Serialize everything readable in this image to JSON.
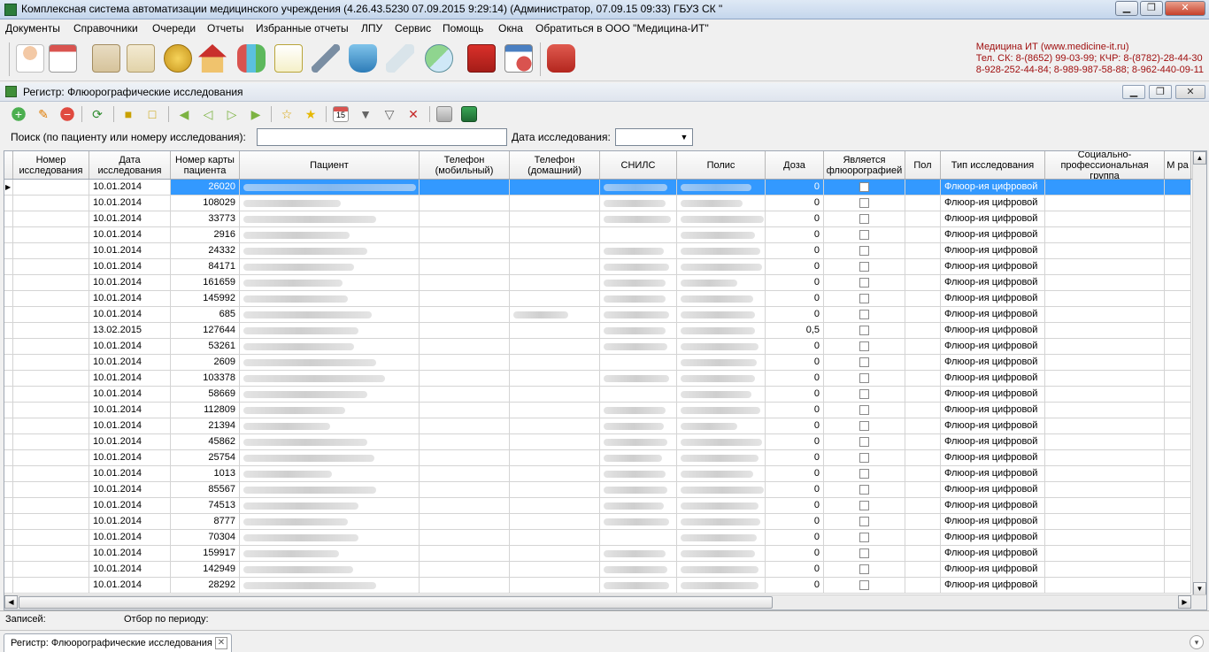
{
  "window": {
    "title": "Комплексная система автоматизации медицинского учреждения (4.26.43.5230 07.09.2015 9:29:14) (Администратор, 07.09.15 09:33) ГБУЗ СК \"",
    "min_label": "▁",
    "max_label": "❐",
    "close_label": "✕"
  },
  "menu": [
    "Документы",
    "Справочники",
    "Очереди",
    "Отчеты",
    "Избранные отчеты",
    "ЛПУ",
    "Сервис",
    "Помощь",
    "Окна",
    "Обратиться в ООО \"Медицина-ИТ\""
  ],
  "contact": {
    "line1": "Медицина ИТ (www.medicine-it.ru)",
    "line2": "Тел. СК: 8-(8652) 99-03-99; КЧР: 8-(8782)-28-44-30",
    "line3": "8-928-252-44-84; 8-989-987-58-88; 8-962-440-09-11"
  },
  "colors": {
    "accent": "#3399ff",
    "contact": "#a01010"
  },
  "child": {
    "title": "Регистр: Флюорографические исследования",
    "min_label": "▁",
    "max_label": "❐",
    "close_label": "✕"
  },
  "search": {
    "label": "Поиск (по пациенту или номеру исследования):",
    "value": "",
    "date_label": "Дата исследования:",
    "date_value": ""
  },
  "columns": [
    "Номер исследования",
    "Дата исследования",
    "Номер карты пациента",
    "Пациент",
    "Телефон (мобильный)",
    "Телефон (домашний)",
    "СНИЛС",
    "Полис",
    "Доза",
    "Является флюорографией",
    "Пол",
    "Тип исследования",
    "Социально-профессиональная группа",
    "М ра"
  ],
  "rows": [
    {
      "date": "10.01.2014",
      "card": "26020",
      "dose": "0",
      "type": "Флюор-ия цифровой"
    },
    {
      "date": "10.01.2014",
      "card": "108029",
      "dose": "0",
      "type": "Флюор-ия цифровой"
    },
    {
      "date": "10.01.2014",
      "card": "33773",
      "dose": "0",
      "type": "Флюор-ия цифровой"
    },
    {
      "date": "10.01.2014",
      "card": "2916",
      "dose": "0",
      "type": "Флюор-ия цифровой"
    },
    {
      "date": "10.01.2014",
      "card": "24332",
      "dose": "0",
      "type": "Флюор-ия цифровой"
    },
    {
      "date": "10.01.2014",
      "card": "84171",
      "dose": "0",
      "type": "Флюор-ия цифровой"
    },
    {
      "date": "10.01.2014",
      "card": "161659",
      "dose": "0",
      "type": "Флюор-ия цифровой"
    },
    {
      "date": "10.01.2014",
      "card": "145992",
      "dose": "0",
      "type": "Флюор-ия цифровой"
    },
    {
      "date": "10.01.2014",
      "card": "685",
      "dose": "0",
      "type": "Флюор-ия цифровой"
    },
    {
      "date": "13.02.2015",
      "card": "127644",
      "dose": "0,5",
      "type": "Флюор-ия цифровой"
    },
    {
      "date": "10.01.2014",
      "card": "53261",
      "dose": "0",
      "type": "Флюор-ия цифровой"
    },
    {
      "date": "10.01.2014",
      "card": "2609",
      "dose": "0",
      "type": "Флюор-ия цифровой"
    },
    {
      "date": "10.01.2014",
      "card": "103378",
      "dose": "0",
      "type": "Флюор-ия цифровой"
    },
    {
      "date": "10.01.2014",
      "card": "58669",
      "dose": "0",
      "type": "Флюор-ия цифровой"
    },
    {
      "date": "10.01.2014",
      "card": "112809",
      "dose": "0",
      "type": "Флюор-ия цифровой"
    },
    {
      "date": "10.01.2014",
      "card": "21394",
      "dose": "0",
      "type": "Флюор-ия цифровой"
    },
    {
      "date": "10.01.2014",
      "card": "45862",
      "dose": "0",
      "type": "Флюор-ия цифровой"
    },
    {
      "date": "10.01.2014",
      "card": "25754",
      "dose": "0",
      "type": "Флюор-ия цифровой"
    },
    {
      "date": "10.01.2014",
      "card": "1013",
      "dose": "0",
      "type": "Флюор-ия цифровой"
    },
    {
      "date": "10.01.2014",
      "card": "85567",
      "dose": "0",
      "type": "Флюор-ия цифровой"
    },
    {
      "date": "10.01.2014",
      "card": "74513",
      "dose": "0",
      "type": "Флюор-ия цифровой"
    },
    {
      "date": "10.01.2014",
      "card": "8777",
      "dose": "0",
      "type": "Флюор-ия цифровой"
    },
    {
      "date": "10.01.2014",
      "card": "70304",
      "dose": "0",
      "type": "Флюор-ия цифровой"
    },
    {
      "date": "10.01.2014",
      "card": "159917",
      "dose": "0",
      "type": "Флюор-ия цифровой"
    },
    {
      "date": "10.01.2014",
      "card": "142949",
      "dose": "0",
      "type": "Флюор-ия цифровой"
    },
    {
      "date": "10.01.2014",
      "card": "28292",
      "dose": "0",
      "type": "Флюор-ия цифровой"
    }
  ],
  "status": {
    "records": "Записей:",
    "period": "Отбор по периоду:"
  },
  "tab": {
    "label": "Регистр: Флюорографические исследования",
    "close": "✕"
  },
  "icons": {
    "main_toolbar": [
      "doctor-icon",
      "calendar-icon",
      "patient-card-icon",
      "document-icon",
      "coins-icon",
      "house-icon",
      "lab-flasks-icon",
      "notepad-icon",
      "syringe-icon",
      "basket-icon",
      "bandage-icon",
      "pill-icon",
      "book-icon",
      "schedule-clock-icon",
      "support-icon"
    ],
    "reg_toolbar": [
      "add-icon",
      "edit-icon",
      "delete-icon",
      "refresh-icon",
      "lock-icon",
      "unlock-icon",
      "first-icon",
      "prev-icon",
      "next-icon",
      "last-icon",
      "favorite-add-icon",
      "favorite-icon",
      "calendar-15-icon",
      "filter-icon",
      "filter-edit-icon",
      "filter-clear-icon",
      "print-icon",
      "export-icon"
    ]
  }
}
